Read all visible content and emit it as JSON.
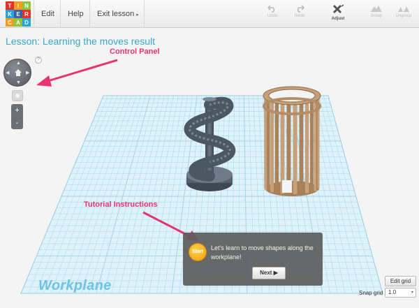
{
  "toolbar": {
    "logo_letters": [
      "T",
      "I",
      "N",
      "K",
      "E",
      "R",
      "C",
      "A",
      "D"
    ],
    "logo_colors": [
      "#e2332a",
      "#f39a1f",
      "#8cc63f",
      "#2aa3d8",
      "#3d5fa8",
      "#e2332a",
      "#f39a1f",
      "#8cc63f",
      "#2aa3d8"
    ],
    "menu": [
      {
        "label": "Edit"
      },
      {
        "label": "Help"
      },
      {
        "label": "Exit lesson",
        "caret": "▸"
      }
    ],
    "tools": {
      "undo": "Undo",
      "redo": "Redo",
      "adjust": "Adjust",
      "group": "Group",
      "ungroup": "Ungroup"
    }
  },
  "lesson": {
    "title": "Lesson: Learning the moves result"
  },
  "view_controls": {
    "help": "?",
    "zoom_in": "+",
    "zoom_out": "-"
  },
  "annotations": {
    "control_panel": "Control Panel",
    "tutorial_instructions": "Tutorial Instructions",
    "accent_color": "#e8336f"
  },
  "tutorial": {
    "badge": "Start",
    "text": "Let's learn to move shapes along the workplane!",
    "next_label": "Next",
    "next_icon": "▶"
  },
  "workplane": {
    "label": "Workplane",
    "grid_color": "#9fd4ea",
    "plane_color": "#dff2fa"
  },
  "shapes": [
    {
      "name": "spiral-staircase",
      "color": "#4c5764"
    },
    {
      "name": "cylindrical-cage",
      "color": "#c7a07a"
    }
  ],
  "grid_controls": {
    "edit_grid": "Edit grid",
    "snap_label": "Snap grid",
    "snap_value": "1.0",
    "caret": "▾"
  }
}
